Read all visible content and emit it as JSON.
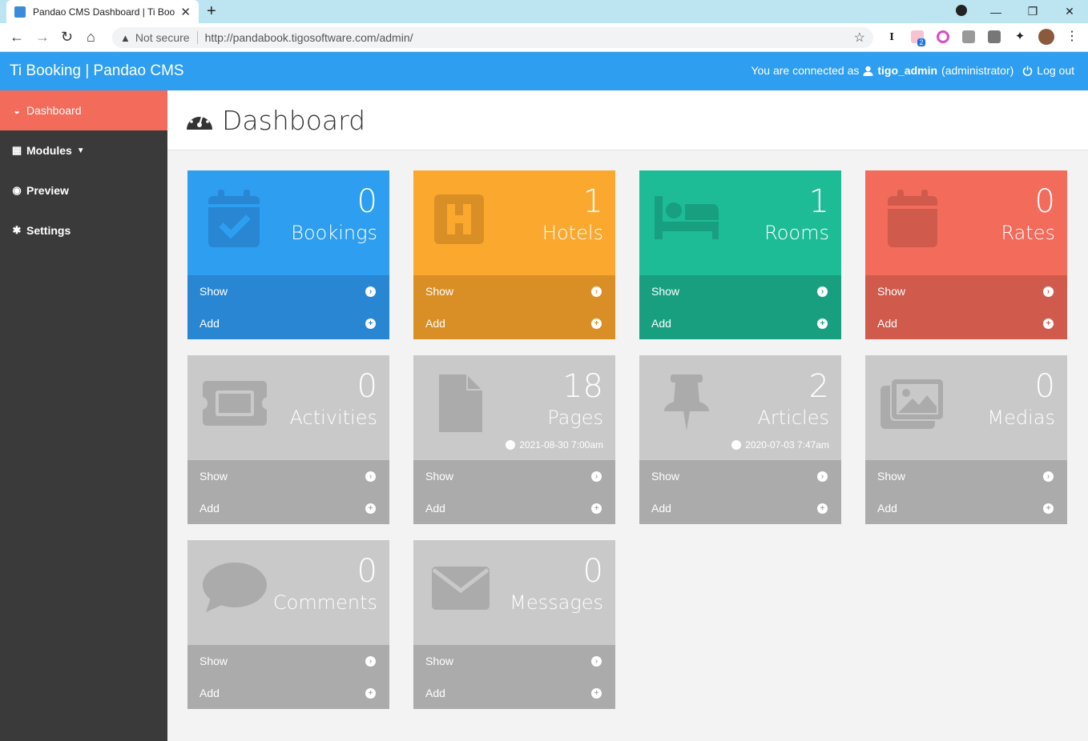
{
  "browser": {
    "tab_title": "Pandao CMS Dashboard | Ti Book",
    "not_secure": "Not secure",
    "url": "http://pandabook.tigosoftware.com/admin/",
    "ext_badge": "2"
  },
  "header": {
    "brand": "Ti Booking | Pandao CMS",
    "connected_prefix": "You are connected as",
    "username": "tigo_admin",
    "role": "(administrator)",
    "logout": "Log out"
  },
  "sidebar": {
    "items": [
      {
        "label": "Dashboard",
        "icon": "dashboard-icon"
      },
      {
        "label": "Modules",
        "icon": "grid-icon"
      },
      {
        "label": "Preview",
        "icon": "eye-icon"
      },
      {
        "label": "Settings",
        "icon": "gear-icon"
      }
    ]
  },
  "page": {
    "title": "Dashboard"
  },
  "actions": {
    "show": "Show",
    "add": "Add"
  },
  "cards": [
    {
      "count": "0",
      "label": "Bookings",
      "icon": "calendar-check-icon",
      "color": "#2e9ef0"
    },
    {
      "count": "1",
      "label": "Hotels",
      "icon": "hospital-h-icon",
      "color": "#fba82f"
    },
    {
      "count": "1",
      "label": "Rooms",
      "icon": "bed-icon",
      "color": "#1dbc97"
    },
    {
      "count": "0",
      "label": "Rates",
      "icon": "calendar-icon",
      "color": "#f26b5b"
    },
    {
      "count": "0",
      "label": "Activities",
      "icon": "ticket-icon",
      "color": "#c9c9c9"
    },
    {
      "count": "18",
      "label": "Pages",
      "icon": "file-icon",
      "color": "#c9c9c9",
      "date": "2021-08-30 7:00am"
    },
    {
      "count": "2",
      "label": "Articles",
      "icon": "pushpin-icon",
      "color": "#c9c9c9",
      "date": "2020-07-03 7:47am"
    },
    {
      "count": "0",
      "label": "Medias",
      "icon": "images-icon",
      "color": "#c9c9c9"
    },
    {
      "count": "0",
      "label": "Comments",
      "icon": "comment-icon",
      "color": "#c9c9c9"
    },
    {
      "count": "0",
      "label": "Messages",
      "icon": "envelope-icon",
      "color": "#c9c9c9"
    }
  ]
}
